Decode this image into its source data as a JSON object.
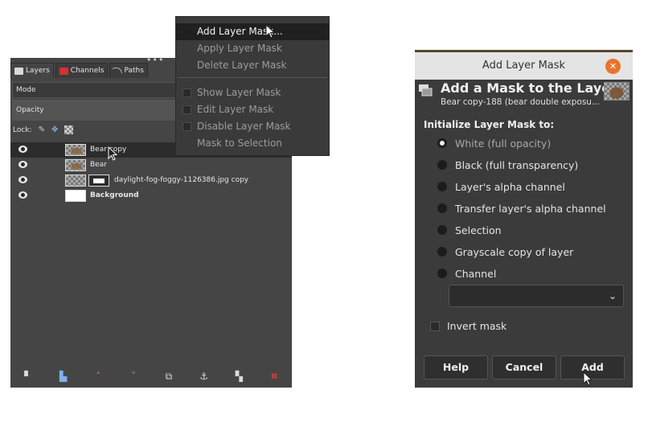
{
  "layers_panel": {
    "tabs": [
      {
        "label": "Layers",
        "icon": "layers-icon"
      },
      {
        "label": "Channels",
        "icon": "channels-icon"
      },
      {
        "label": "Paths",
        "icon": "paths-icon"
      }
    ],
    "mode_label": "Mode",
    "opacity_label": "Opacity",
    "lock_label": "Lock:",
    "layers": [
      {
        "name": "Bear copy",
        "selected": true
      },
      {
        "name": "Bear",
        "selected": false
      },
      {
        "name": "daylight-fog-foggy-1126386.jpg copy",
        "selected": false
      },
      {
        "name": "Background",
        "selected": false
      }
    ],
    "bottom_icons": [
      "new-layer-icon",
      "new-layer-group-icon",
      "raise-layer-icon",
      "lower-layer-icon",
      "duplicate-layer-icon",
      "anchor-layer-icon",
      "layer-mask-icon",
      "delete-layer-icon"
    ]
  },
  "context_menu": {
    "items": [
      {
        "label": "Add Layer Mask...",
        "highlighted": true
      },
      {
        "label": "Apply Layer Mask"
      },
      {
        "label": "Delete Layer Mask"
      },
      {
        "label": "Show Layer Mask"
      },
      {
        "label": "Edit Layer Mask"
      },
      {
        "label": "Disable Layer Mask"
      },
      {
        "label": "Mask to Selection"
      }
    ]
  },
  "dialog": {
    "window_title": "Add Layer Mask",
    "header_title": "Add a Mask to the Layer",
    "header_subtitle": "Bear copy-188 (bear double exposu...",
    "section_label": "Initialize Layer Mask to:",
    "options": [
      {
        "label": "White (full opacity)",
        "checked": true
      },
      {
        "label": "Black (full transparency)",
        "checked": false
      },
      {
        "label": "Layer's alpha channel",
        "checked": false
      },
      {
        "label": "Transfer layer's alpha channel",
        "checked": false
      },
      {
        "label": "Selection",
        "checked": false
      },
      {
        "label": "Grayscale copy of layer",
        "checked": false
      },
      {
        "label": "Channel",
        "checked": false
      }
    ],
    "channel_select_value": "",
    "invert_mask_label": "Invert mask",
    "buttons": {
      "help": "Help",
      "cancel": "Cancel",
      "add": "Add"
    }
  },
  "colors": {
    "panel_bg": "#454545",
    "dialog_bg": "#3b3b3b",
    "close_button": "#e9732c"
  }
}
